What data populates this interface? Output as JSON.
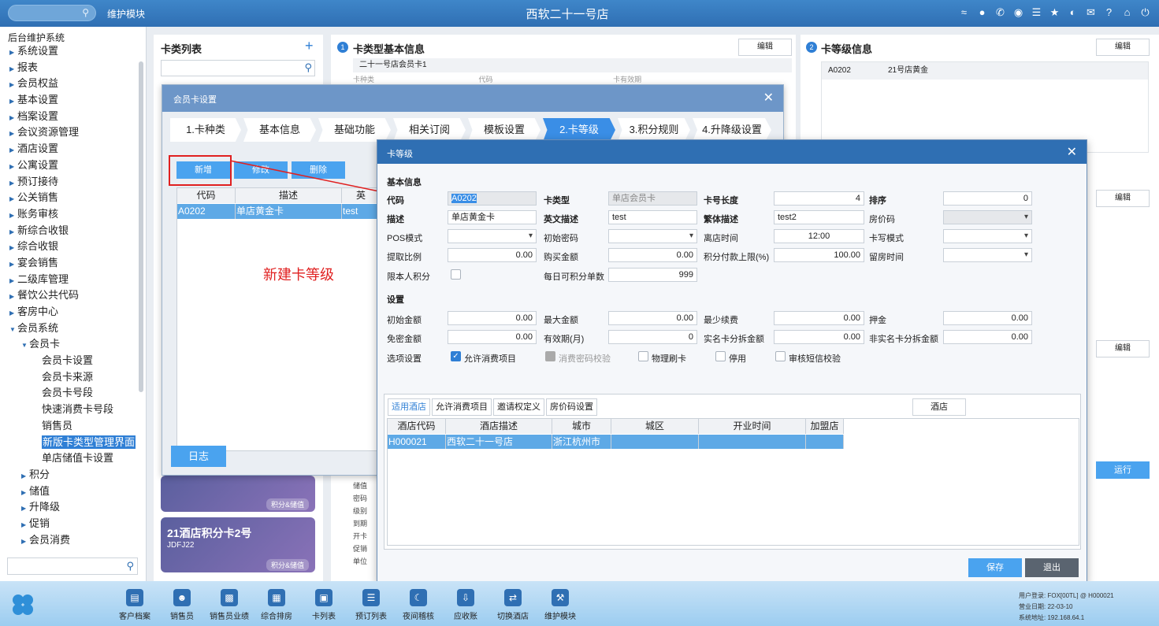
{
  "topbar": {
    "module": "维护模块",
    "title": "西软二十一号店",
    "icons": [
      "wifi-icon",
      "chat-icon",
      "phone-icon",
      "palette-icon",
      "menu-icon",
      "star-icon",
      "contrast-icon",
      "mail-icon",
      "help-icon",
      "home-icon",
      "power-icon"
    ]
  },
  "sidebar": {
    "root": "后台维护系统",
    "items": [
      {
        "label": "系统设置",
        "level": 1,
        "arrow": "right"
      },
      {
        "label": "报表",
        "level": 1,
        "arrow": "right"
      },
      {
        "label": "会员权益",
        "level": 1,
        "arrow": "right"
      },
      {
        "label": "基本设置",
        "level": 1,
        "arrow": "right"
      },
      {
        "label": "档案设置",
        "level": 1,
        "arrow": "right"
      },
      {
        "label": "会议资源管理",
        "level": 1,
        "arrow": "right"
      },
      {
        "label": "酒店设置",
        "level": 1,
        "arrow": "right"
      },
      {
        "label": "公寓设置",
        "level": 1,
        "arrow": "right"
      },
      {
        "label": "预订接待",
        "level": 1,
        "arrow": "right"
      },
      {
        "label": "公关销售",
        "level": 1,
        "arrow": "right"
      },
      {
        "label": "账务审核",
        "level": 1,
        "arrow": "right"
      },
      {
        "label": "新综合收银",
        "level": 1,
        "arrow": "right"
      },
      {
        "label": "综合收银",
        "level": 1,
        "arrow": "right"
      },
      {
        "label": "宴会销售",
        "level": 1,
        "arrow": "right"
      },
      {
        "label": "二级库管理",
        "level": 1,
        "arrow": "right"
      },
      {
        "label": "餐饮公共代码",
        "level": 1,
        "arrow": "right"
      },
      {
        "label": "客房中心",
        "level": 1,
        "arrow": "right"
      },
      {
        "label": "会员系统",
        "level": 1,
        "arrow": "down"
      },
      {
        "label": "会员卡",
        "level": 2,
        "arrow": "down"
      },
      {
        "label": "会员卡设置",
        "level": 3,
        "arrow": ""
      },
      {
        "label": "会员卡来源",
        "level": 3,
        "arrow": ""
      },
      {
        "label": "会员卡号段",
        "level": 3,
        "arrow": ""
      },
      {
        "label": "快速消费卡号段",
        "level": 3,
        "arrow": ""
      },
      {
        "label": "销售员",
        "level": 3,
        "arrow": ""
      },
      {
        "label": "新版卡类型管理界面",
        "level": 3,
        "arrow": "",
        "selected": true
      },
      {
        "label": "单店储值卡设置",
        "level": 3,
        "arrow": ""
      },
      {
        "label": "积分",
        "level": 2,
        "arrow": "right"
      },
      {
        "label": "储值",
        "level": 2,
        "arrow": "right"
      },
      {
        "label": "升降级",
        "level": 2,
        "arrow": "right"
      },
      {
        "label": "促销",
        "level": 2,
        "arrow": "right"
      },
      {
        "label": "会员消费",
        "level": 2,
        "arrow": "right"
      }
    ]
  },
  "cardlist": {
    "title": "卡类列表",
    "cards": [
      {
        "name": "",
        "code": "",
        "tag": "积分&储值"
      },
      {
        "name": "21酒店积分卡2号",
        "code": "JDFJ22",
        "tag": "积分&储值"
      }
    ]
  },
  "midpanel": {
    "title": "卡类型基本信息",
    "badge": "1",
    "edit": "编辑",
    "subheader": "二十一号店会员卡1",
    "cols": [
      "卡种类",
      "代码",
      "卡有效期"
    ],
    "rows": [
      "储值",
      "密码",
      "级别",
      "到期",
      "开卡",
      "促销",
      "单位"
    ]
  },
  "rightpanel": {
    "title": "卡等级信息",
    "badge": "2",
    "edit": "编辑",
    "row": {
      "code": "A0202",
      "name": "21号店黄金"
    },
    "run": "运行"
  },
  "dialog1": {
    "title": "会员卡设置",
    "steps": [
      "1.卡种类",
      "基本信息",
      "基础功能",
      "相关订阅",
      "模板设置",
      "2.卡等级",
      "3.积分规则",
      "4.升降级设置"
    ],
    "active_step": 5,
    "buttons": {
      "new": "新增",
      "edit": "修改",
      "delete": "删除"
    },
    "table": {
      "headers": [
        "代码",
        "描述",
        "英"
      ],
      "row": [
        "A0202",
        "单店黄金卡",
        "test"
      ]
    },
    "annotation": "新建卡等级",
    "log": "日志"
  },
  "dialog2": {
    "title": "卡等级",
    "section_basic": "基本信息",
    "section_setting": "设置",
    "fields": {
      "code_label": "代码",
      "code": "A0202",
      "cardtype_label": "卡类型",
      "cardtype": "单店会员卡",
      "cardlen_label": "卡号长度",
      "cardlen": "4",
      "sort_label": "排序",
      "sort": "0",
      "desc_label": "描述",
      "desc": "单店黄金卡",
      "edesc_label": "英文描述",
      "edesc": "test",
      "tdesc_label": "繁体描述",
      "tdesc": "test2",
      "roomcode_label": "房价码",
      "roomcode": "",
      "pos_label": "POS模式",
      "pos": "",
      "initpwd_label": "初始密码",
      "initpwd": "",
      "leave_label": "离店时间",
      "leave": "12:00",
      "cardwrite_label": "卡写模式",
      "cardwrite": "",
      "ratio_label": "提取比例",
      "ratio": "0.00",
      "buy_label": "购买金额",
      "buy": "0.00",
      "ptlimit_label": "积分付款上限(%)",
      "ptlimit": "100.00",
      "hold_label": "留房时间",
      "hold": "",
      "selfpt_label": "限本人积分",
      "daily_label": "每日可积分单数",
      "daily": "999",
      "initamt_label": "初始金额",
      "initamt": "0.00",
      "maxamt_label": "最大金额",
      "maxamt": "0.00",
      "minfee_label": "最少续费",
      "minfee": "0.00",
      "deposit_label": "押金",
      "deposit": "0.00",
      "freepwd_label": "免密金额",
      "freepwd": "0.00",
      "valid_label": "有效期(月)",
      "valid": "0",
      "realsplit_label": "实名卡分拆金额",
      "realsplit": "0.00",
      "nonrealsplit_label": "非实名卡分拆金额",
      "nonrealsplit": "0.00",
      "options_label": "选项设置"
    },
    "options": [
      {
        "label": "允许消费项目",
        "state": "on"
      },
      {
        "label": "消费密码校验",
        "state": "disabled"
      },
      {
        "label": "物理刷卡",
        "state": "off"
      },
      {
        "label": "停用",
        "state": "off"
      },
      {
        "label": "审核短信校验",
        "state": "off"
      }
    ],
    "subtabs": [
      "适用酒店",
      "允许消费项目",
      "邀请权定义",
      "房价码设置"
    ],
    "hotel_button": "酒店",
    "hotel_table": {
      "headers": [
        "酒店代码",
        "酒店描述",
        "城市",
        "城区",
        "开业时间",
        "加盟店"
      ],
      "row": [
        "H000021",
        "西软二十一号店",
        "浙江杭州市",
        "",
        "",
        ""
      ]
    },
    "save": "保存",
    "exit": "退出"
  },
  "bottombar": {
    "nav": [
      "客户档案",
      "销售员",
      "销售员业绩",
      "综合排房",
      "卡列表",
      "预订列表",
      "夜间稽核",
      "应收账",
      "切换酒店",
      "维护模块"
    ],
    "status": {
      "user_label": "用户登录:",
      "user": "FOX[00TL] @ H000021",
      "bizdate_label": "营业日期:",
      "bizdate": "22-03-10",
      "addr_label": "系统地址:",
      "addr": "192.168.64.1"
    }
  }
}
